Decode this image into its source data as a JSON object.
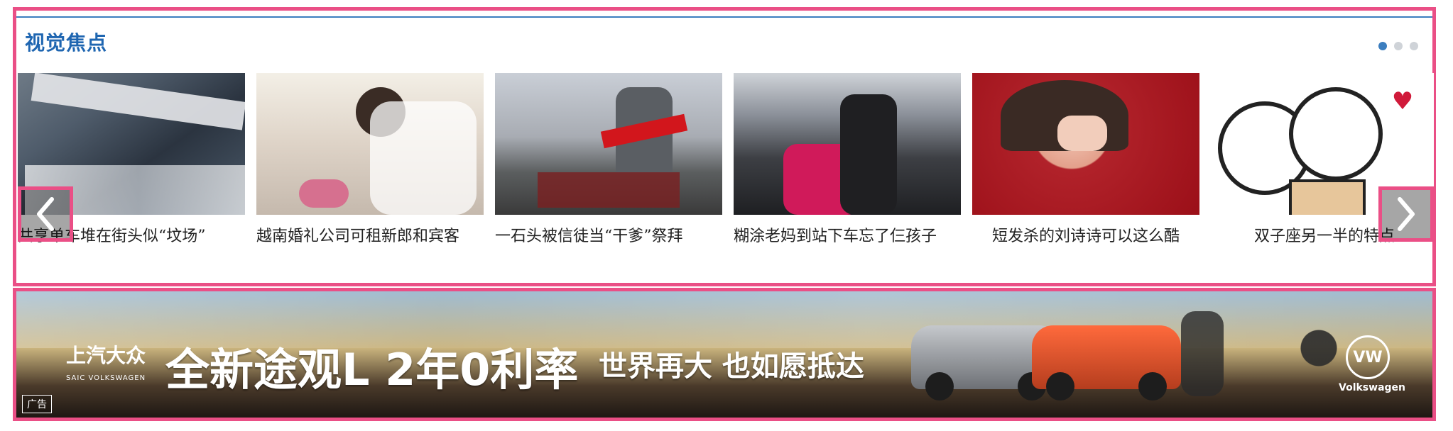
{
  "focus": {
    "title": "视觉焦点",
    "pagination": {
      "total": 3,
      "active": 1
    },
    "items": [
      {
        "caption": "共享单车堆在街头似“坟场”"
      },
      {
        "caption": "越南婚礼公司可租新郎和宾客"
      },
      {
        "caption": "一石头被信徒当“干爹”祭拜"
      },
      {
        "caption": "糊涂老妈到站下车忘了仨孩子"
      },
      {
        "caption": "短发杀的刘诗诗可以这么酷"
      },
      {
        "caption": "双子座另一半的特点"
      }
    ]
  },
  "ad": {
    "brand_cn": "上汽大众",
    "brand_en": "SAIC VOLKSWAGEN",
    "headline": "全新途观L 2年0利率",
    "slogan": "世界再大 也如愿抵达",
    "vw_badge": "VW",
    "vw_text": "Volkswagen",
    "tag": "广告"
  },
  "colors": {
    "accent": "#1f66b1",
    "highlight_border": "#ea4f86"
  }
}
